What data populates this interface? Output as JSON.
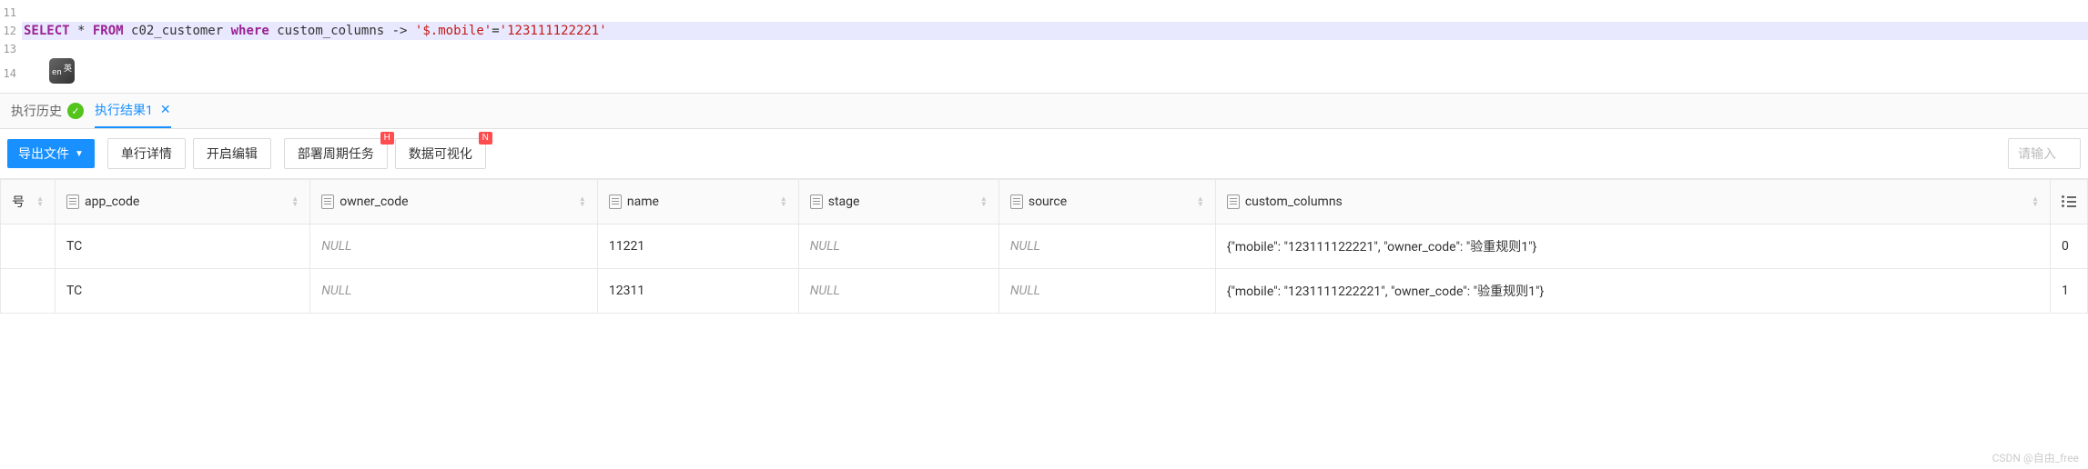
{
  "editor": {
    "lines": [
      {
        "num": "11",
        "code": ""
      },
      {
        "num": "12",
        "code_tokens": [
          {
            "t": "SELECT",
            "cls": "kw"
          },
          {
            "t": " * ",
            "cls": "punc"
          },
          {
            "t": "FROM",
            "cls": "kw"
          },
          {
            "t": " c02_customer ",
            "cls": "ident"
          },
          {
            "t": "where",
            "cls": "kw"
          },
          {
            "t": "   custom_columns -> ",
            "cls": "ident"
          },
          {
            "t": "'$.mobile'",
            "cls": "str"
          },
          {
            "t": "=",
            "cls": "punc"
          },
          {
            "t": "'123111122221'",
            "cls": "str"
          }
        ]
      },
      {
        "num": "13",
        "code": ""
      },
      {
        "num": "14",
        "code": ""
      }
    ]
  },
  "tabs": {
    "history_label": "执行历史",
    "result_label": "执行结果1"
  },
  "toolbar": {
    "export_label": "导出文件",
    "row_detail": "单行详情",
    "enable_edit": "开启编辑",
    "deploy_task": "部署周期任务",
    "deploy_badge": "H",
    "data_vis": "数据可视化",
    "data_vis_badge": "N",
    "search_placeholder": "请输入"
  },
  "table": {
    "headers": [
      "号",
      "app_code",
      "owner_code",
      "name",
      "stage",
      "source",
      "custom_columns",
      ""
    ],
    "rows": [
      {
        "rowno": "",
        "app_code": "TC",
        "owner_code": "NULL",
        "name": "11221",
        "stage": "NULL",
        "source": "NULL",
        "custom_columns": "{\"mobile\": \"123111122221\", \"owner_code\": \"验重规则1\"}",
        "last": "0"
      },
      {
        "rowno": "",
        "app_code": "TC",
        "owner_code": "NULL",
        "name": "12311",
        "stage": "NULL",
        "source": "NULL",
        "custom_columns": "{\"mobile\": \"1231111222221\", \"owner_code\": \"验重规则1\"}",
        "last": "1"
      }
    ]
  },
  "watermark": "CSDN @自由_free"
}
